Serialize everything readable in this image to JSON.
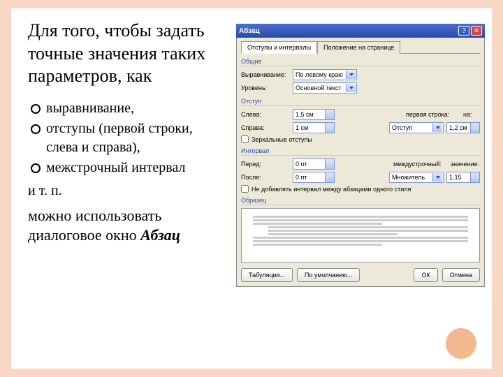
{
  "text": {
    "heading": "Для того, чтобы задать точные значения таких параметров, как",
    "bullets": [
      "выравнивание,",
      "отступы (первой строки, слева и справа),",
      "межстрочный интервал"
    ],
    "etc": "и т. п.",
    "para_pre": "можно использовать диалоговое окно ",
    "para_bold": "Абзац"
  },
  "dlg": {
    "title": "Абзац",
    "tabs": {
      "t1": "Отступы и интервалы",
      "t2": "Положение на странице"
    },
    "groups": {
      "general": "Общие",
      "indent": "Отступ",
      "interval": "Интервал",
      "preview": "Образец"
    },
    "labels": {
      "align": "Выравнивание:",
      "level": "Уровень:",
      "left": "Слева:",
      "right": "Справа:",
      "firstline": "первая строка:",
      "by1": "на:",
      "mirror": "Зеркальные отступы",
      "before": "Перед:",
      "after": "После:",
      "linespace": "междустрочный:",
      "by2": "значение:",
      "noadd": "Не добавлять интервал между абзацами одного стиля"
    },
    "values": {
      "align": "По левому краю",
      "level": "Основной текст",
      "left": "1,5 см",
      "right": "1 см",
      "firstline": "Отступ",
      "by1": "1,2 см",
      "before": "0 пт",
      "after": "0 пт",
      "linespace": "Множитель",
      "by2": "1,15"
    },
    "buttons": {
      "tabs": "Табуляция...",
      "default": "По умолчанию...",
      "ok": "ОК",
      "cancel": "Отмена"
    }
  }
}
